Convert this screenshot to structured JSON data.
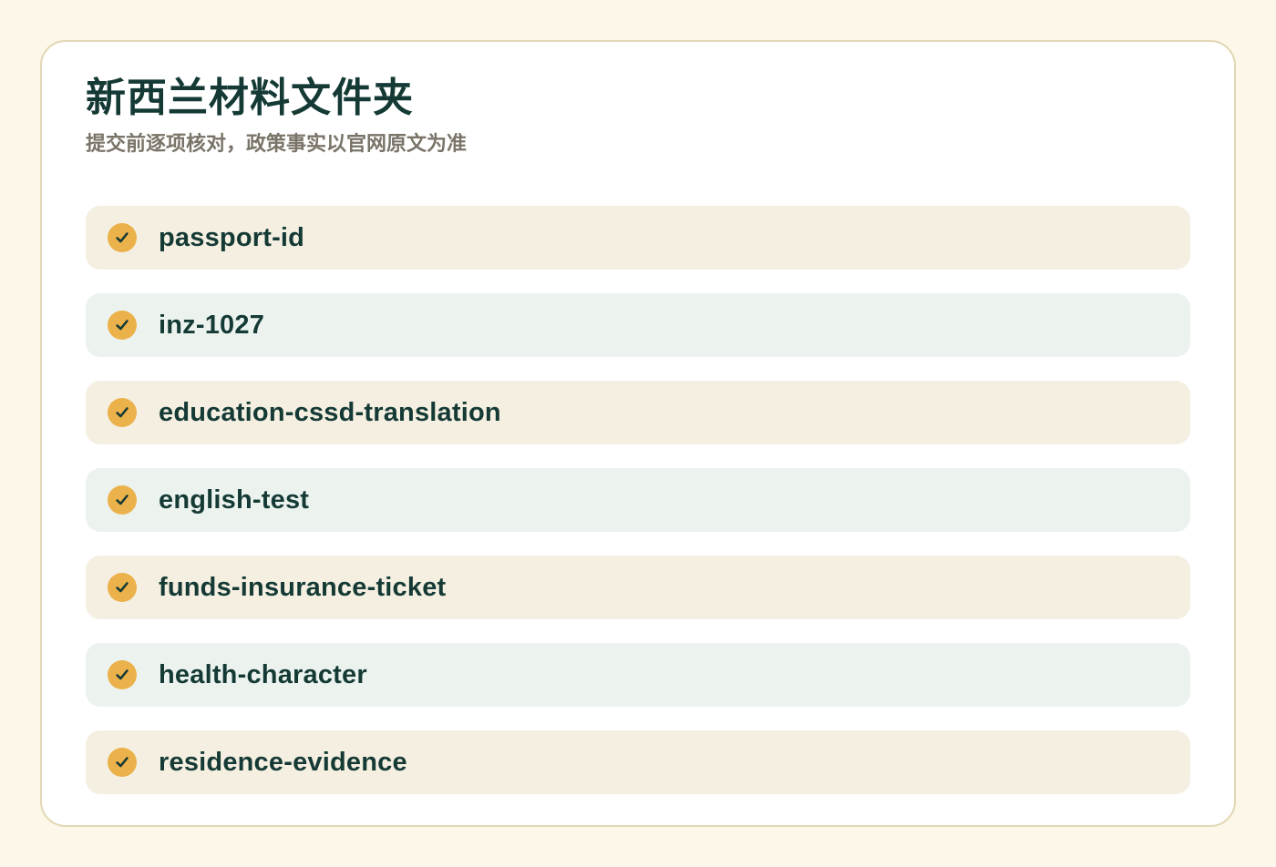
{
  "header": {
    "title": "新西兰材料文件夹",
    "subtitle": "提交前逐项核对，政策事实以官网原文为准"
  },
  "checklist": {
    "check_icon": "check-circle-icon",
    "accent_color": "#ebb14a",
    "items": [
      {
        "label": "passport-id"
      },
      {
        "label": "inz-1027"
      },
      {
        "label": "education-cssd-translation"
      },
      {
        "label": "english-test"
      },
      {
        "label": "funds-insurance-ticket"
      },
      {
        "label": "health-character"
      },
      {
        "label": "residence-evidence"
      }
    ]
  }
}
